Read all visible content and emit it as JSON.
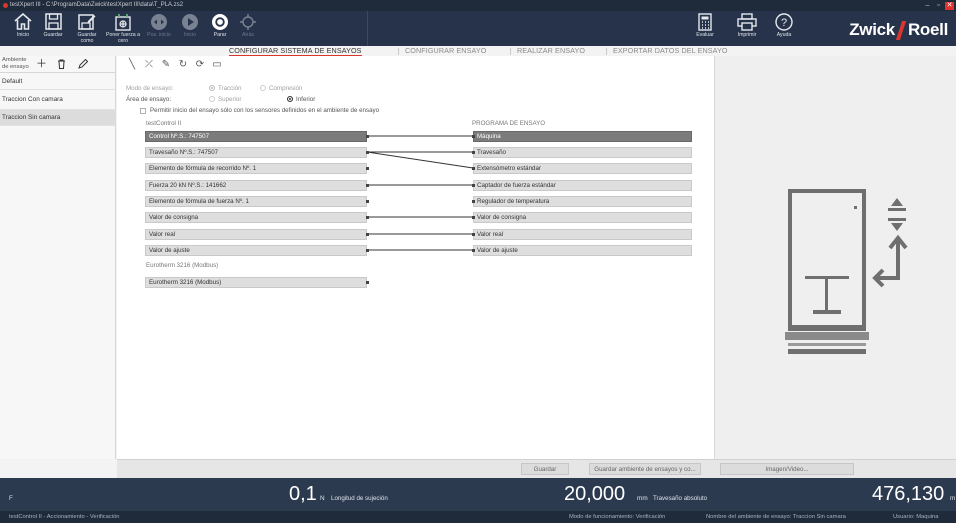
{
  "window": {
    "title": "testXpert III - C:\\ProgramData\\Zwick\\testXpert III\\data\\T_PLA.zs2",
    "controls": [
      "–",
      "▫",
      "✕"
    ]
  },
  "toolbar": {
    "home": "Inicio",
    "save": "Guardar",
    "save_as": "Guardar como",
    "zero_force": "Poner fuerza a cero",
    "pos_start": "Pos. inicio",
    "start": "Inicio",
    "stop": "Parar",
    "back": "Atrás",
    "evaluate": "Evaluar",
    "print": "Imprimir",
    "help": "Ayuda",
    "logo_left": "Zwick",
    "logo_right": "Roell"
  },
  "tabs": [
    {
      "label": "CONFIGURAR SISTEMA DE ENSAYOS",
      "active": true
    },
    {
      "label": "CONFIGURAR ENSAYO",
      "active": false
    },
    {
      "label": "REALIZAR ENSAYO",
      "active": false
    },
    {
      "label": "EXPORTAR DATOS DEL ENSAYO",
      "active": false
    }
  ],
  "left_panel": {
    "title": "Ambiente de ensayo",
    "icons": [
      "plus-icon",
      "trash-icon",
      "edit-icon"
    ],
    "items": [
      {
        "label": "Default",
        "selected": false
      },
      {
        "label": "Traccion Con camara",
        "selected": false
      },
      {
        "label": "Traccion Sin camara",
        "selected": true
      }
    ]
  },
  "main": {
    "icon_row": [
      "line-icon",
      "unlink-icon",
      "edit-icon",
      "refresh-icon",
      "sync-icon",
      "window-icon"
    ],
    "mode_label": "Modo de ensayo:",
    "mode_options": [
      {
        "label": "Tracción",
        "selected": true
      },
      {
        "label": "Compresión",
        "selected": false
      }
    ],
    "area_label": "Área de ensayo:",
    "area_options": [
      {
        "label": "Superior",
        "selected": false
      },
      {
        "label": "Inferior",
        "selected": true
      }
    ],
    "permit_label": "Permitir inicio del ensayo sólo con los sensores definidos en el ambiente de ensayo",
    "source_title": "testControl II",
    "sources": [
      "Control Nº.S.: 747507",
      "Travesaño Nº.S.: 747507",
      "Elemento de fórmula de recorrido Nº. 1",
      "Fuerza 20 kN Nº.S.: 141662",
      "Elemento de fórmula de fuerza Nº. 1",
      "Valor de consigna",
      "Valor real",
      "Valor de ajuste"
    ],
    "source2_title": "Eurotherm 3216 (Modbus)",
    "sources2": [
      "Eurotherm 3216 (Modbus)"
    ],
    "target_title": "PROGRAMA DE ENSAYO",
    "targets": [
      "Máquina",
      "Travesaño",
      "Extensómetro estándar",
      "Captador de fuerza estándar",
      "Regulador de temperatura",
      "Valor de consigna",
      "Valor real",
      "Valor de ajuste"
    ]
  },
  "buttons": {
    "save": "Guardar",
    "save_env": "Guardar ambiente de ensayos y co...",
    "image_video": "Imagen/Video..."
  },
  "readouts": {
    "left_label": "F",
    "force_value": "0,1",
    "force_unit": "N",
    "force_desc": "Longitud de sujeción",
    "cross_value": "20,000",
    "cross_unit": "mm",
    "cross_desc": "Travesaño absoluto",
    "right_value": "476,130",
    "right_unit": "m"
  },
  "status": {
    "left": "testControl II - Accionamiento - Verificación",
    "mode": "Modo de funcionamiento: Verificación",
    "env": "Nombre del ambiente de ensayo: Traccion Sin camara",
    "user": "Usuario: Maquina"
  }
}
